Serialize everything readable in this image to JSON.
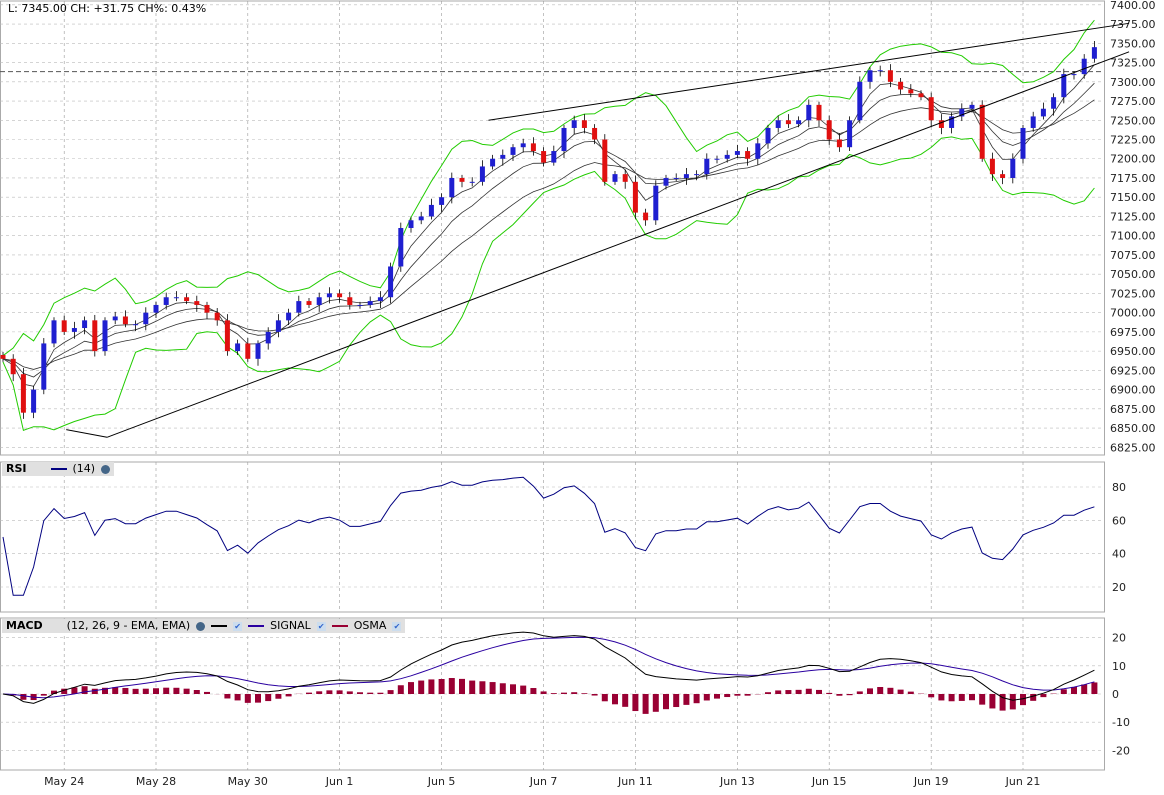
{
  "info": "L: 7345.00 CH: +31.75 CH%: 0.43%",
  "rsi_header": {
    "name": "RSI",
    "params": "(14)"
  },
  "macd_header": {
    "name": "MACD",
    "params": "(12, 26, 9 - EMA, EMA)",
    "signal": "SIGNAL",
    "osma": "OSMA"
  },
  "colors": {
    "up": "#1f1fd0",
    "down": "#e01010",
    "band": "#22cc00",
    "ema": "#000000",
    "rsi": "#000080",
    "macd": "#000000",
    "signal": "#2a00a0",
    "osma": "#990033"
  },
  "chart_data": {
    "type": "candlestick",
    "x_labels": [
      {
        "i": 6,
        "t": "May 24"
      },
      {
        "i": 15,
        "t": "May 28"
      },
      {
        "i": 24,
        "t": "May 30"
      },
      {
        "i": 33,
        "t": "Jun 1"
      },
      {
        "i": 43,
        "t": "Jun 5"
      },
      {
        "i": 53,
        "t": "Jun 7"
      },
      {
        "i": 62,
        "t": "Jun 11"
      },
      {
        "i": 72,
        "t": "Jun 13"
      },
      {
        "i": 81,
        "t": "Jun 15"
      },
      {
        "i": 91,
        "t": "Jun 19"
      },
      {
        "i": 100,
        "t": "Jun 21"
      }
    ],
    "price_ticks": [
      7400,
      7375,
      7350,
      7325,
      7300,
      7275,
      7250,
      7225,
      7200,
      7175,
      7150,
      7125,
      7100,
      7075,
      7050,
      7025,
      7000,
      6975,
      6950,
      6925,
      6900,
      6875,
      6850,
      6825
    ],
    "ylim": [
      6815,
      7405
    ],
    "closes": [
      6940,
      6920,
      6870,
      6900,
      6960,
      6990,
      6975,
      6980,
      6990,
      6950,
      6990,
      6995,
      6985,
      6985,
      7000,
      7010,
      7020,
      7020,
      7015,
      7010,
      7000,
      6990,
      6950,
      6960,
      6940,
      6960,
      6975,
      6990,
      7000,
      7015,
      7010,
      7020,
      7025,
      7020,
      7010,
      7010,
      7015,
      7020,
      7060,
      7110,
      7120,
      7125,
      7140,
      7150,
      7175,
      7170,
      7170,
      7190,
      7200,
      7205,
      7215,
      7220,
      7210,
      7195,
      7210,
      7240,
      7250,
      7240,
      7225,
      7170,
      7180,
      7170,
      7130,
      7120,
      7165,
      7175,
      7175,
      7180,
      7180,
      7200,
      7200,
      7205,
      7210,
      7200,
      7220,
      7240,
      7250,
      7245,
      7250,
      7270,
      7250,
      7225,
      7215,
      7250,
      7300,
      7315,
      7315,
      7300,
      7290,
      7285,
      7280,
      7250,
      7240,
      7255,
      7265,
      7270,
      7200,
      7180,
      7175,
      7200,
      7240,
      7255,
      7265,
      7280,
      7310,
      7310,
      7330,
      7345
    ],
    "prev_close": 7313.25,
    "trendlines": [
      [
        6.2,
        6848,
        10.2,
        6838
      ],
      [
        10.2,
        6838,
        110.4,
        7339
      ],
      [
        47.6,
        7250,
        110.4,
        7376
      ]
    ],
    "rsi": {
      "period": 14,
      "ticks": [
        80,
        60,
        40,
        20
      ],
      "ylim": [
        5,
        95
      ]
    },
    "macd": {
      "fast": 12,
      "slow": 26,
      "signal": 9,
      "ticks": [
        20,
        10,
        0,
        -10,
        -20
      ],
      "ylim": [
        -27,
        27
      ]
    }
  }
}
